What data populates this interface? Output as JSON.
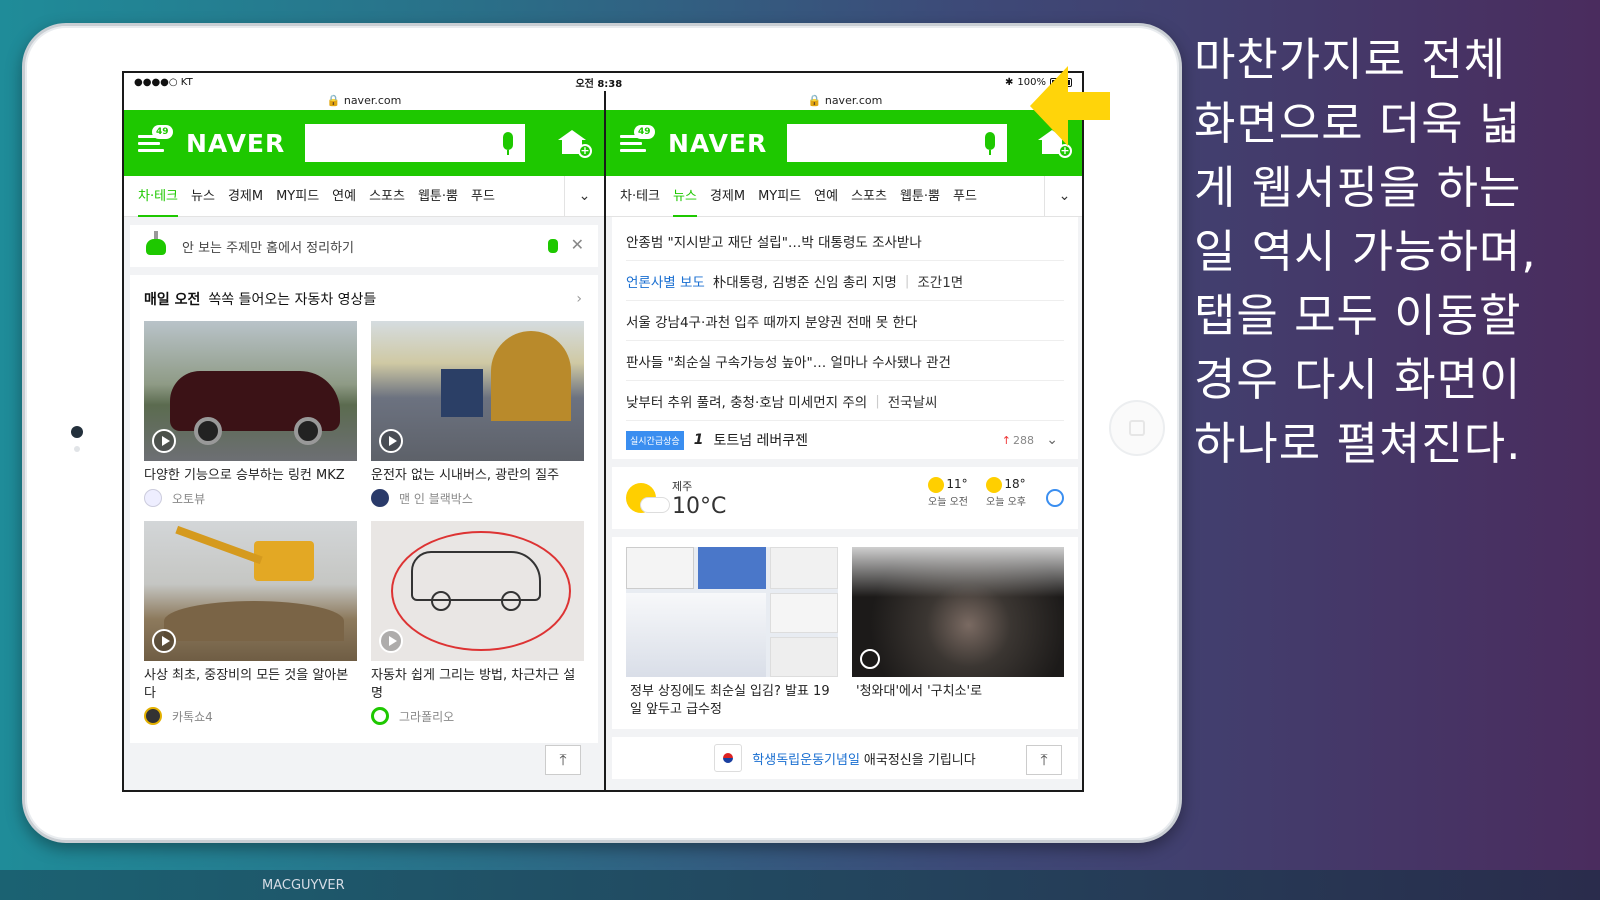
{
  "status_bar": {
    "carrier": "●●●●○ KT",
    "time": "오전 8:38",
    "battery": "100%"
  },
  "left_pane": {
    "url": "naver.com",
    "logo": "NAVER",
    "menu_badge": "49",
    "tabs": [
      "차·테크",
      "뉴스",
      "경제M",
      "MY피드",
      "연예",
      "스포츠",
      "웹툰·뿜",
      "푸드"
    ],
    "active_tab": "차·테크",
    "tip_text": "안 보는 주제만 홈에서 정리하기",
    "feed_label_bold": "매일 오전",
    "feed_label": "쏙쏙 들어오는 자동차 영상들",
    "items": [
      {
        "title": "다양한 기능으로 승부하는 링컨 MKZ",
        "source": "오토뷰"
      },
      {
        "title": "운전자 없는 시내버스, 광란의 질주",
        "source": "맨 인 블랙박스"
      },
      {
        "title": "사상 최초, 중장비의 모든 것을 알아본다",
        "source": "카톡쇼4"
      },
      {
        "title": "자동차 쉽게 그리는 방법, 차근차근 설명",
        "source": "그라폴리오"
      }
    ]
  },
  "right_pane": {
    "url": "naver.com",
    "logo": "NAVER",
    "menu_badge": "49",
    "tabs": [
      "차·테크",
      "뉴스",
      "경제M",
      "MY피드",
      "연예",
      "스포츠",
      "웹툰·뿜",
      "푸드"
    ],
    "active_tab": "뉴스",
    "news": [
      {
        "kw": "",
        "text": "안종범 \"지시받고 재단 설립\"…박 대통령도 조사받나",
        "aux": ""
      },
      {
        "kw": "언론사별 보도",
        "text": "朴대통령, 김병준 신임 총리 지명",
        "aux": "조간1면"
      },
      {
        "kw": "",
        "text": "서울 강남4구·과천 입주 때까지 분양권 전매 못 한다",
        "aux": ""
      },
      {
        "kw": "",
        "text": "판사들 \"최순실 구속가능성 높아\"… 얼마나 수사됐나 관건",
        "aux": ""
      },
      {
        "kw": "",
        "text": "낮부터 추위 풀려, 충청·호남 미세먼지 주의",
        "aux": "전국날씨"
      }
    ],
    "realtime": {
      "tag": "실시간급상승",
      "rank": "1",
      "keyword": "토트넘 레버쿠젠",
      "count": "288"
    },
    "weather": {
      "city": "제주",
      "temp": "10°C",
      "morning": {
        "temp": "11°",
        "label": "오늘 오전"
      },
      "afternoon": {
        "temp": "18°",
        "label": "오늘 오후"
      }
    },
    "photos": [
      {
        "caption": "정부 상징에도 최순실 입김? 발표 19일 앞두고 급수정"
      },
      {
        "caption": "'청와대'에서 '구치소'로"
      }
    ],
    "banner": {
      "kw": "학생독립운동기념일",
      "text": "애국정신을 기립니다"
    }
  },
  "caption_lines": [
    "마찬가지로 전체",
    "화면으로 더욱 넓",
    "게 웹서핑을 하는",
    "일 역시 가능하며,",
    "탭을 모두 이동할",
    "경우 다시 화면이",
    "하나로 펼쳐진다."
  ],
  "footer": "MACGUYVER",
  "colors": {
    "naver_green": "#1ec800",
    "arrow": "#ffd40a",
    "link_blue": "#1a6fd1"
  }
}
